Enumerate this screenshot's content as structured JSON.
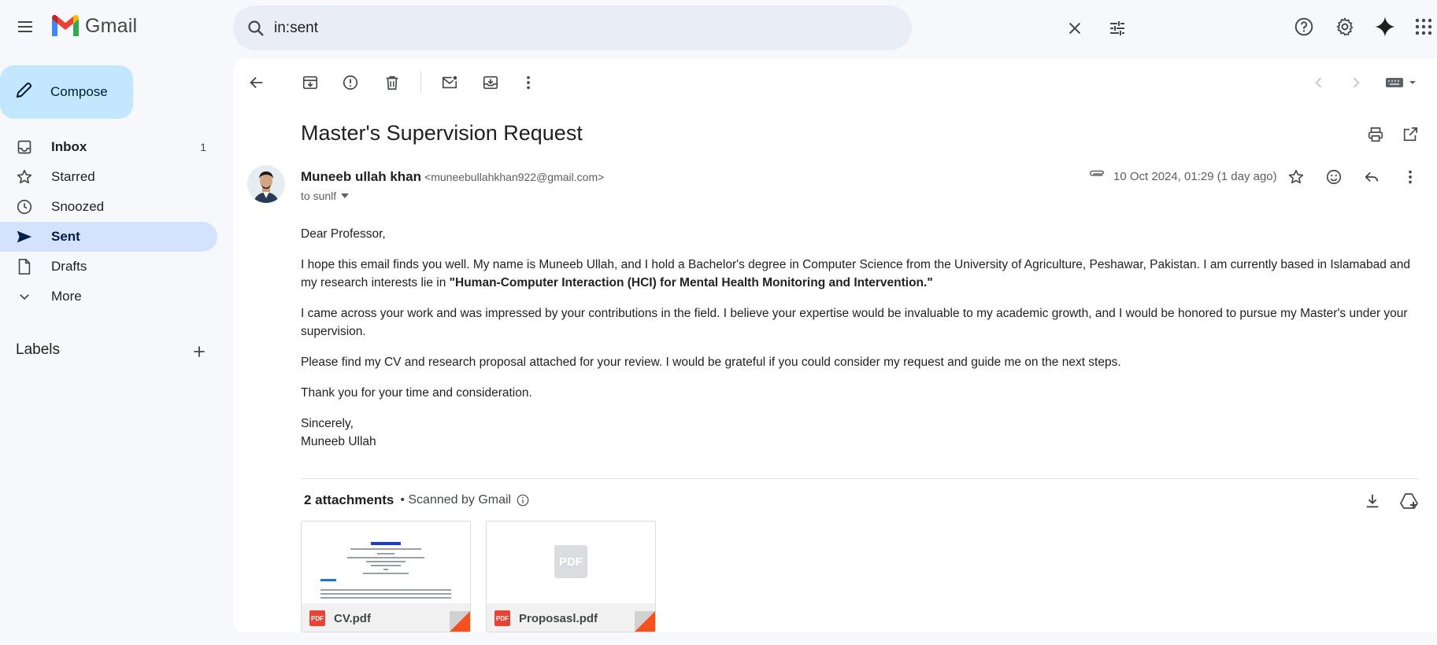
{
  "app": {
    "name": "Gmail"
  },
  "search": {
    "query": "in:sent"
  },
  "sidebar": {
    "compose_label": "Compose",
    "items": [
      {
        "label": "Inbox",
        "count": "1"
      },
      {
        "label": "Starred"
      },
      {
        "label": "Snoozed"
      },
      {
        "label": "Sent"
      },
      {
        "label": "Drafts"
      },
      {
        "label": "More"
      }
    ],
    "labels_heading": "Labels"
  },
  "email": {
    "subject": "Master's Supervision Request",
    "sender_name": "Muneeb ullah khan",
    "sender_email": "<muneebullahkhan922@gmail.com>",
    "to": "to sunlf",
    "date": "10 Oct 2024, 01:29 (1 day ago)",
    "body": {
      "greeting": "Dear Professor,",
      "p1_text": "I hope this email finds you well. My name is Muneeb Ullah, and I hold a Bachelor's degree in Computer Science from the University of Agriculture, Peshawar, Pakistan. I am currently based in Islamabad and my research interests lie in ",
      "p1_bold": "\"Human-Computer Interaction (HCI) for Mental Health Monitoring and Intervention.\"",
      "p2": "I came across your work and was impressed by your contributions in the field. I believe your expertise would be invaluable to my academic growth, and I would be honored to pursue my Master's under your supervision.",
      "p3": "Please find my CV and research proposal attached for your review. I would be grateful if you could consider my request and guide me on the next steps.",
      "p4": "Thank you for your time and consideration.",
      "closing": "Sincerely,",
      "signature": "Muneeb Ullah"
    },
    "attachments": {
      "count_label": "2 attachments",
      "scanned_label": "• Scanned by Gmail",
      "files": [
        {
          "name": "CV.pdf",
          "type_badge": "PDF"
        },
        {
          "name": "Proposasl.pdf",
          "type_badge": "PDF",
          "placeholder_label": "PDF"
        }
      ]
    }
  },
  "colors": {
    "background": "#f6f8fc",
    "compose_bg": "#c2e7ff",
    "active_nav": "#d3e3fd",
    "search_bg": "#e9eef6",
    "pdf_red": "#ea4335"
  },
  "icons": [
    "menu-icon",
    "gmail-logo",
    "search-icon",
    "close-icon",
    "tune-icon",
    "help-icon",
    "gear-icon",
    "gemini-sparkle-icon",
    "apps-grid-icon",
    "pencil-icon",
    "inbox-icon",
    "star-icon",
    "clock-icon",
    "send-icon",
    "file-icon",
    "chevron-down-icon",
    "plus-icon",
    "arrow-back-icon",
    "archive-icon",
    "report-spam-icon",
    "trash-icon",
    "mark-unread-icon",
    "move-to-icon",
    "more-vert-icon",
    "chevron-left-icon",
    "chevron-right-icon",
    "keyboard-icon",
    "print-icon",
    "open-in-new-icon",
    "attachment-clip-icon",
    "emoji-icon",
    "reply-icon",
    "download-icon",
    "add-to-drive-icon",
    "info-icon"
  ]
}
